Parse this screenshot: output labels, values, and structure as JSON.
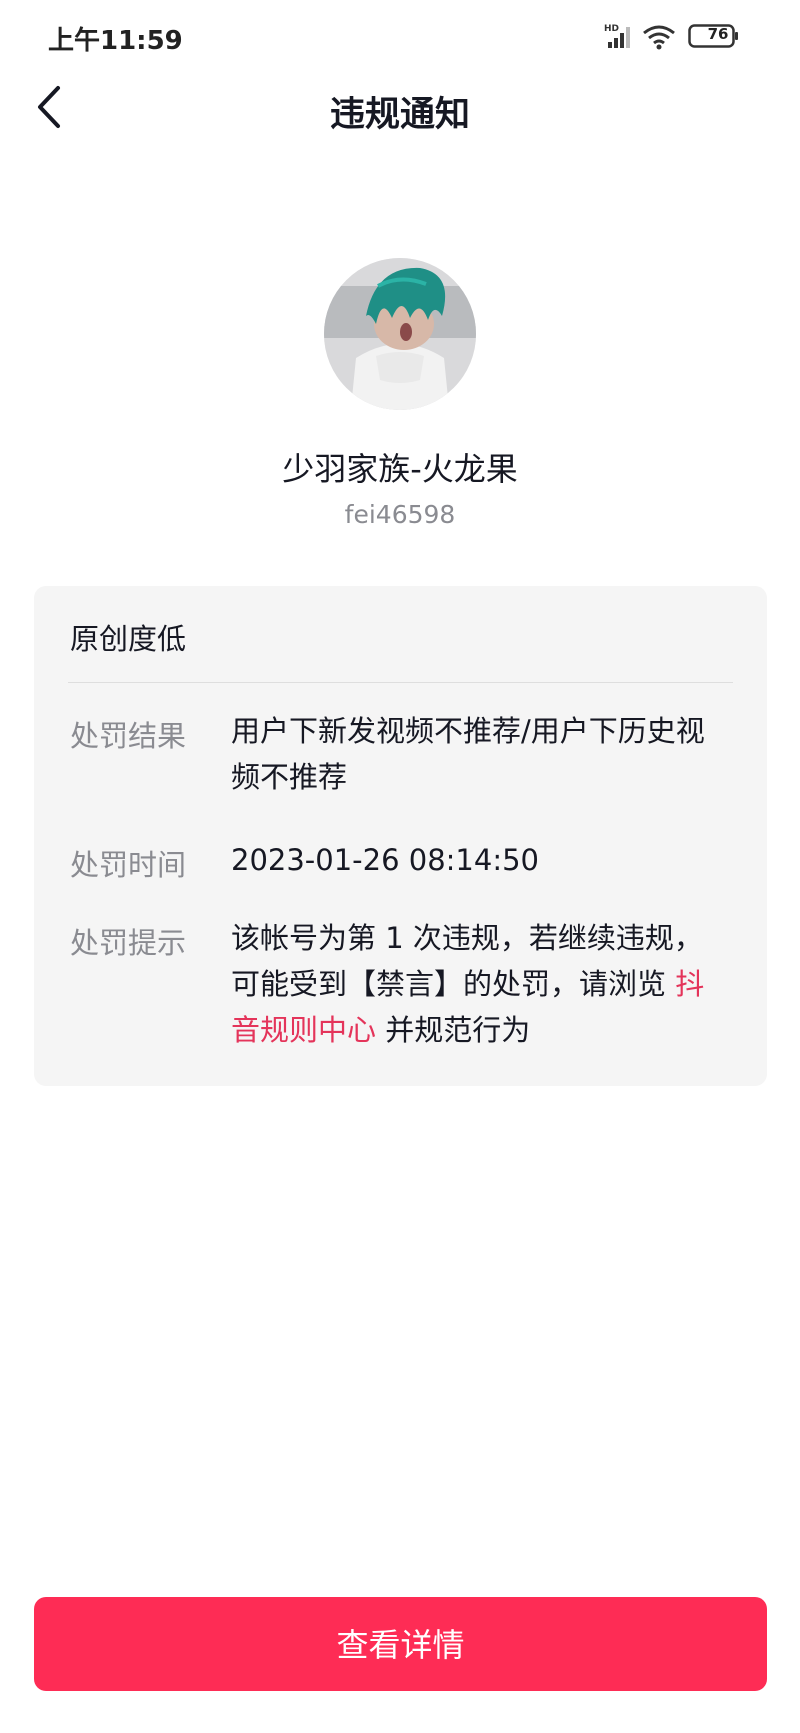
{
  "status_bar": {
    "time": "上午11:59",
    "network_label": "HD",
    "battery": "76"
  },
  "header": {
    "title": "违规通知"
  },
  "profile": {
    "name": "少羽家族-火龙果",
    "id": "fei46598"
  },
  "violation": {
    "reason": "原创度低",
    "rows": [
      {
        "label": "处罚结果",
        "value": "用户下新发视频不推荐/用户下历史视频不推荐"
      },
      {
        "label": "处罚时间",
        "value": "2023-01-26 08:14:50"
      }
    ],
    "hint": {
      "label": "处罚提示",
      "text_before": "该帐号为第 1 次违规，若继续违规，可能受到【禁言】的处罚，请浏览 ",
      "link": "抖音规则中心",
      "text_after": " 并规范行为"
    }
  },
  "footer": {
    "button_label": "查看详情"
  },
  "colors": {
    "accent": "#fe2c55",
    "link": "#e4345a",
    "card_bg": "#f5f5f5",
    "secondary_text": "#8a8b91"
  }
}
